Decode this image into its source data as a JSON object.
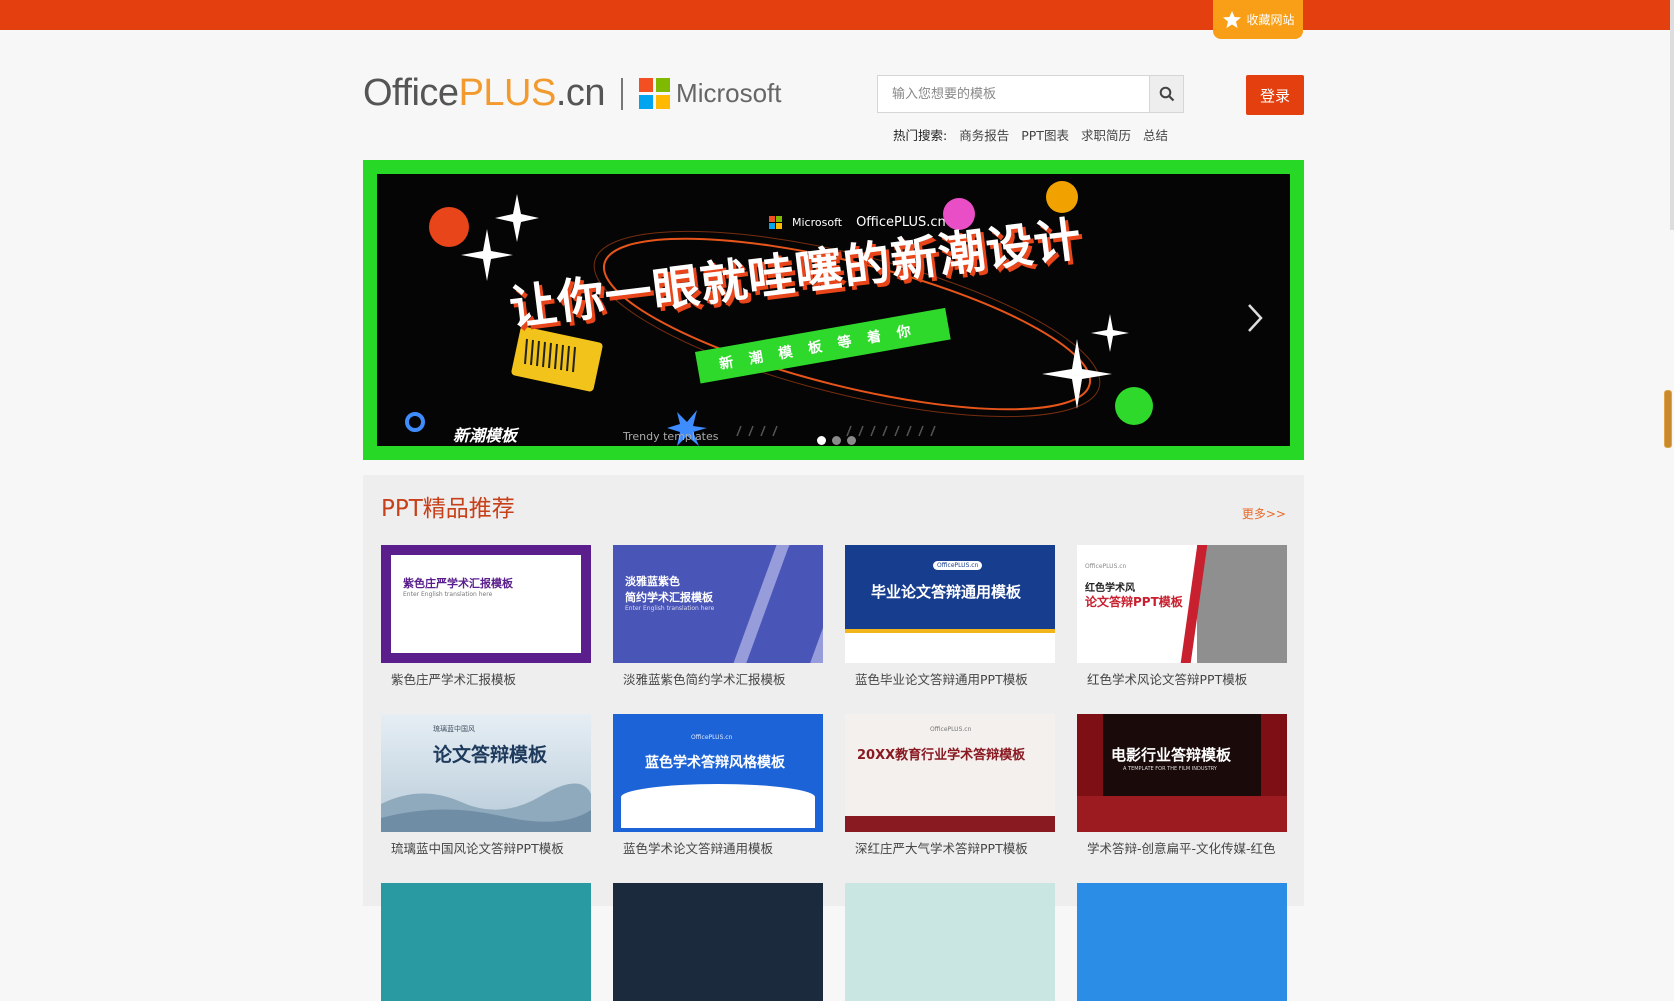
{
  "topbar": {
    "favorite_label": "收藏网站"
  },
  "header": {
    "logo_office": "Office",
    "logo_plus": "PLUS",
    "logo_cn": ".cn",
    "logo_microsoft": "Microsoft",
    "search_placeholder": "输入您想要的模板",
    "login_label": "登录",
    "hot_label": "热门搜索:",
    "hot_tags": [
      "商务报告",
      "PPT图表",
      "求职简历",
      "总结"
    ]
  },
  "banner": {
    "partner_ms": "Microsoft",
    "partner_office": "OfficePLUS.cn",
    "headline": "让你一眼就哇噻的新潮设计",
    "subline": "新潮模板等着你",
    "trendy_cn": "新潮模板",
    "trendy_en": "Trendy templates",
    "slide_count": 3,
    "active_slide": 1
  },
  "section": {
    "title": "PPT精品推荐",
    "more_label": "更多>>",
    "cards": [
      {
        "title": "紫色庄严学术汇报模板",
        "thumb_text": "紫色庄严学术汇报模板",
        "thumb_sub": "Enter English translation here"
      },
      {
        "title": "淡雅蓝紫色简约学术汇报模板",
        "thumb_text": "淡雅蓝紫色",
        "thumb_text2": "简约学术汇报模板",
        "thumb_sub": "Enter English translation here"
      },
      {
        "title": "蓝色毕业论文答辩通用PPT模板",
        "thumb_text": "毕业论文答辩通用模板",
        "thumb_sub": "OfficePLUS.cn"
      },
      {
        "title": "红色学术风论文答辩PPT模板",
        "thumb_text": "红色学术风",
        "thumb_text2": "论文答辩PPT模板",
        "thumb_sub": "OfficePLUS.cn"
      },
      {
        "title": "琉璃蓝中国风论文答辩PPT模板",
        "thumb_text": "论文答辩模板",
        "thumb_sub": "琉璃蓝中国风"
      },
      {
        "title": "蓝色学术论文答辩通用模板",
        "thumb_text": "蓝色学术答辩风格模板",
        "thumb_sub": "OfficePLUS.cn"
      },
      {
        "title": "深红庄严大气学术答辩PPT模板",
        "thumb_text": "20XX教育行业学术答辩模板",
        "thumb_sub": "OfficePLUS.cn"
      },
      {
        "title": "学术答辩-创意扁平-文化传媒-红色",
        "thumb_text": "电影行业答辩模板",
        "thumb_sub": "A TEMPLATE FOR THE FILM INDUSTRY"
      }
    ]
  },
  "colors": {
    "brand_orange": "#e33f0f",
    "favorite_orange": "#f89f17",
    "banner_green": "#28d826"
  }
}
